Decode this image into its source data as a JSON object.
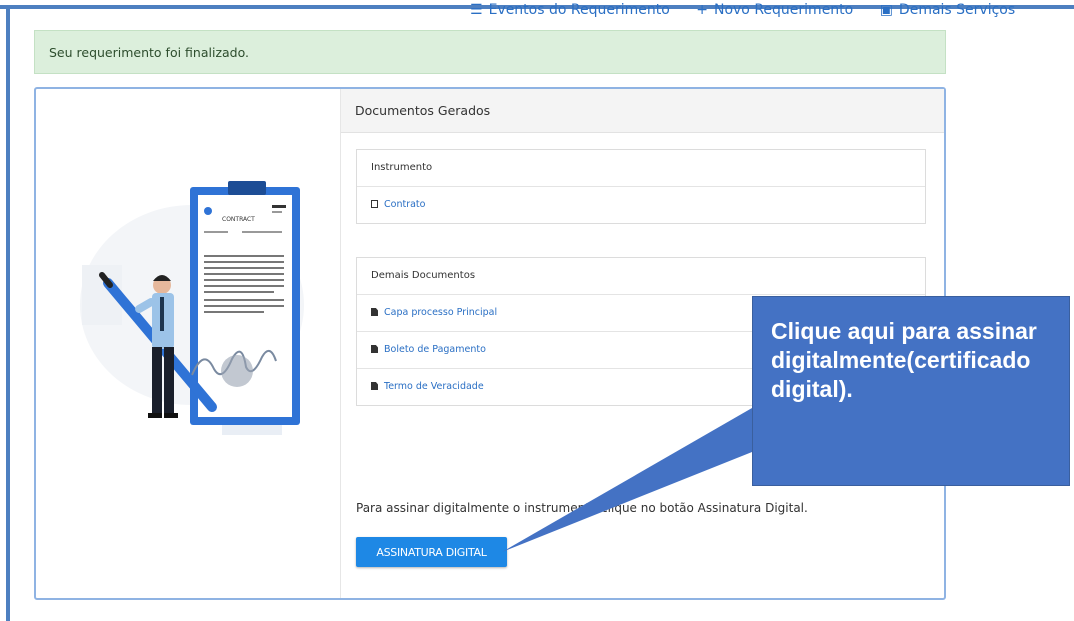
{
  "topnav": {
    "items": [
      {
        "icon": "list-icon",
        "label": "Eventos do Requerimento"
      },
      {
        "icon": "plus-icon",
        "label": "Novo Requerimento"
      },
      {
        "icon": "services-icon",
        "label": "Demais Serviços"
      }
    ]
  },
  "alert": {
    "message": "Seu requerimento foi finalizado."
  },
  "panel": {
    "title": "Documentos Gerados",
    "instrumento": {
      "title": "Instrumento",
      "items": [
        {
          "label": "Contrato",
          "icon": "file-outline-icon"
        }
      ]
    },
    "demais": {
      "title": "Demais Documentos",
      "items": [
        {
          "label": "Capa processo Principal",
          "icon": "file-icon"
        },
        {
          "label": "Boleto de Pagamento",
          "icon": "file-icon"
        },
        {
          "label": "Termo de Veracidade",
          "icon": "file-icon"
        }
      ]
    },
    "instruction": "Para assinar digitalmente o instrumento clique no botão Assinatura Digital.",
    "sign_button": "ASSINATURA DIGITAL"
  },
  "illustration": {
    "contract_label": "CONTRACT"
  },
  "callout": {
    "text": "Clique aqui para assinar digitalmente(certificado digital)."
  },
  "colors": {
    "accent": "#1e88e5",
    "callout": "#4472c4",
    "alert_bg": "#dcefdc",
    "frame": "#4d7fc0"
  }
}
